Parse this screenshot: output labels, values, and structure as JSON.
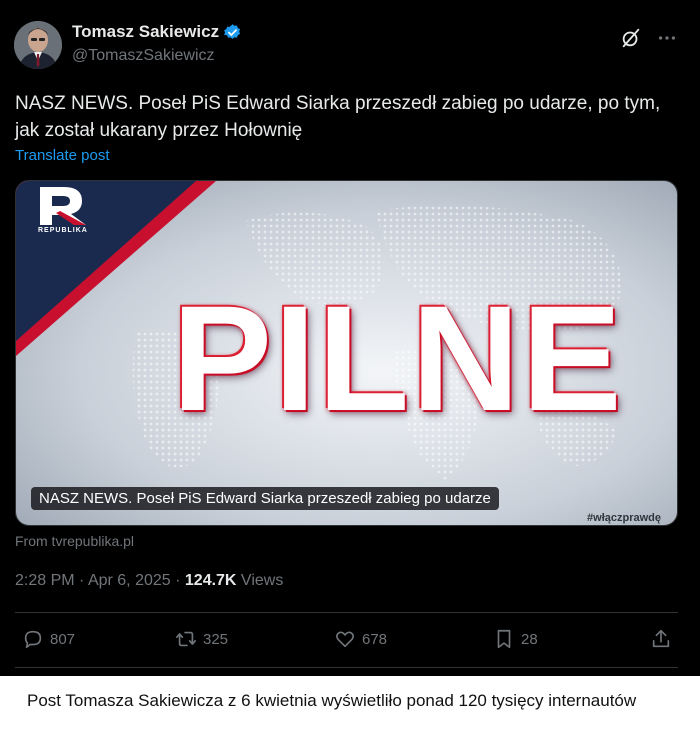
{
  "author": {
    "name": "Tomasz Sakiewicz",
    "handle": "@TomaszSakiewicz"
  },
  "post": {
    "text": "NASZ NEWS. Poseł PiS Edward Siarka przeszedł zabieg po udarze, po tym, jak został ukarany przez Hołownię",
    "translate_label": "Translate post"
  },
  "media": {
    "headline": "PILNE",
    "logo_text": "REPUBLIKA",
    "caption": "NASZ NEWS. Poseł PiS Edward Siarka przeszedł zabieg po udarze",
    "hashtag": "#włączprawdę"
  },
  "source": "From tvrepublika.pl",
  "meta": {
    "time": "2:28 PM",
    "sep1": " · ",
    "date": "Apr 6, 2025",
    "sep2": " · ",
    "views_count": "124.7K",
    "views_label": " Views"
  },
  "actions": {
    "replies": "807",
    "reposts": "325",
    "likes": "678",
    "bookmarks": "28"
  },
  "caption": "Post Tomasza Sakiewicza z 6 kwietnia wyświetliło ponad 120 tysięcy internautów",
  "colors": {
    "background": "#000000",
    "text": "#e7e9ea",
    "muted": "#71767b",
    "link": "#1d9bf0",
    "verified": "#1d9bf0",
    "brand_red": "#c8102e",
    "brand_navy": "#1a2a4f"
  }
}
